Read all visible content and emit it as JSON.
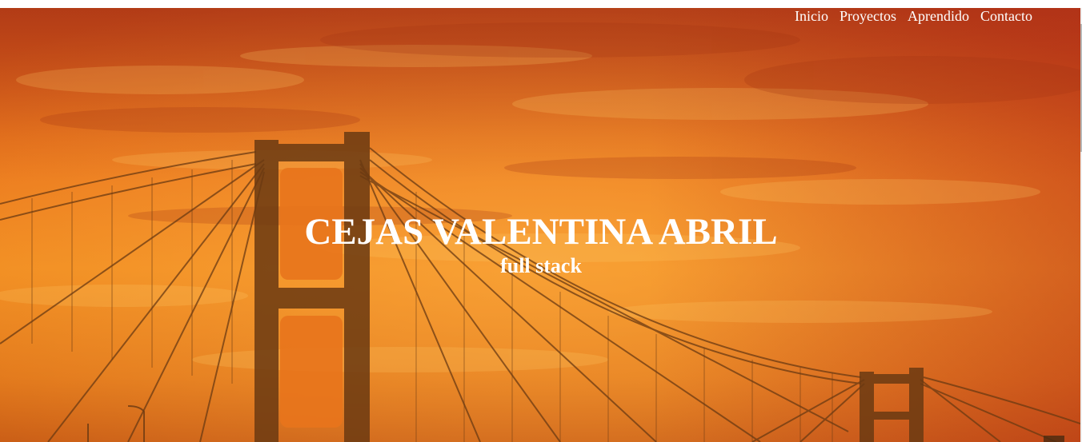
{
  "nav": {
    "items": [
      {
        "label": "Inicio"
      },
      {
        "label": "Proyectos"
      },
      {
        "label": "Aprendido"
      },
      {
        "label": "Contacto"
      }
    ]
  },
  "hero": {
    "title": "CEJAS VALENTINA ABRIL",
    "subtitle": "full stack",
    "background_image": "sunset-suspension-bridge-photo"
  },
  "colors": {
    "sky_top": "#c8451a",
    "sky_mid": "#f08a1e",
    "bridge_silhouette": "#6b3a12",
    "text": "#ffffff"
  }
}
